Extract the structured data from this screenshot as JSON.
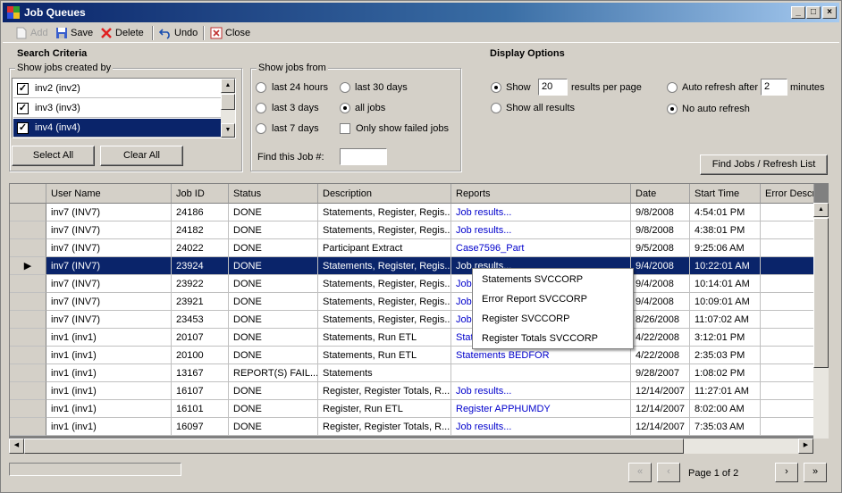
{
  "window": {
    "title": "Job Queues",
    "minimize_glyph": "_",
    "maximize_glyph": "□",
    "close_glyph": "×"
  },
  "toolbar": {
    "add": "Add",
    "save": "Save",
    "delete": "Delete",
    "undo": "Undo",
    "close": "Close"
  },
  "search": {
    "heading": "Search Criteria",
    "created_by_label": "Show jobs created by",
    "users": [
      {
        "label": "inv2 (inv2)",
        "checked": true
      },
      {
        "label": "inv3 (inv3)",
        "checked": true
      },
      {
        "label": "inv4 (inv4)",
        "checked": true,
        "selected": true
      }
    ],
    "select_all": "Select All",
    "clear_all": "Clear All",
    "jobs_from_label": "Show jobs from",
    "ranges": {
      "last24": "last 24 hours",
      "last30": "last 30 days",
      "last3": "last 3 days",
      "all": "all jobs",
      "last7": "last 7 days",
      "failed_only": "Only show failed jobs"
    },
    "selected_range": "all jobs",
    "find_job_label": "Find this Job #:",
    "find_job_value": ""
  },
  "display": {
    "heading": "Display Options",
    "show_label": "Show",
    "show_count": "20",
    "per_page_label": "results per page",
    "show_all": "Show all results",
    "auto_refresh_label": "Auto refresh after",
    "auto_refresh_value": "2",
    "minutes_label": "minutes",
    "no_auto_refresh": "No auto refresh",
    "find_button": "Find Jobs / Refresh List"
  },
  "grid": {
    "columns": [
      "User Name",
      "Job ID",
      "Status",
      "Description",
      "Reports",
      "Date",
      "Start Time",
      "Error Descri"
    ],
    "rows": [
      [
        "inv7 (INV7)",
        "24186",
        "DONE",
        "Statements, Register, Regis...",
        "Job results...",
        "9/8/2008",
        "4:54:01 PM",
        ""
      ],
      [
        "inv7 (INV7)",
        "24182",
        "DONE",
        "Statements, Register, Regis...",
        "Job results...",
        "9/8/2008",
        "4:38:01 PM",
        ""
      ],
      [
        "inv7 (INV7)",
        "24022",
        "DONE",
        "Participant Extract",
        "Case7596_Part",
        "9/5/2008",
        "9:25:06 AM",
        ""
      ],
      [
        "inv7 (INV7)",
        "23924",
        "DONE",
        "Statements, Register, Regis...",
        "Job results...",
        "9/4/2008",
        "10:22:01 AM",
        ""
      ],
      [
        "inv7 (INV7)",
        "23922",
        "DONE",
        "Statements, Register, Regis...",
        "Job",
        "9/4/2008",
        "10:14:01 AM",
        ""
      ],
      [
        "inv7 (INV7)",
        "23921",
        "DONE",
        "Statements, Register, Regis...",
        "Job",
        "9/4/2008",
        "10:09:01 AM",
        ""
      ],
      [
        "inv7 (INV7)",
        "23453",
        "DONE",
        "Statements, Register, Regis...",
        "Job",
        "8/26/2008",
        "11:07:02 AM",
        ""
      ],
      [
        "inv1 (inv1)",
        "20107",
        "DONE",
        "Statements, Run ETL",
        "Stat",
        "4/22/2008",
        "3:12:01 PM",
        ""
      ],
      [
        "inv1 (inv1)",
        "20100",
        "DONE",
        "Statements, Run ETL",
        "Statements BEDFOR",
        "4/22/2008",
        "2:35:03 PM",
        ""
      ],
      [
        "inv1 (inv1)",
        "13167",
        "REPORT(S) FAIL...",
        "Statements",
        "",
        "9/28/2007",
        "1:08:02 PM",
        ""
      ],
      [
        "inv1 (inv1)",
        "16107",
        "DONE",
        "Register, Register Totals, R...",
        "Job results...",
        "12/14/2007",
        "11:27:01 AM",
        ""
      ],
      [
        "inv1 (inv1)",
        "16101",
        "DONE",
        "Register, Run ETL",
        "Register APPHUMDY",
        "12/14/2007",
        "8:02:00 AM",
        ""
      ],
      [
        "inv1 (inv1)",
        "16097",
        "DONE",
        "Register, Register Totals, R...",
        "Job results...",
        "12/14/2007",
        "7:35:03 AM",
        ""
      ]
    ],
    "selected_row": 3,
    "row_marker": "▶"
  },
  "context_menu": [
    "Statements SVCCORP",
    "Error Report SVCCORP",
    "Register SVCCORP",
    "Register Totals SVCCORP"
  ],
  "pager": {
    "first": "«",
    "prev": "‹",
    "label": "Page 1 of 2",
    "next": "›",
    "last": "»"
  }
}
